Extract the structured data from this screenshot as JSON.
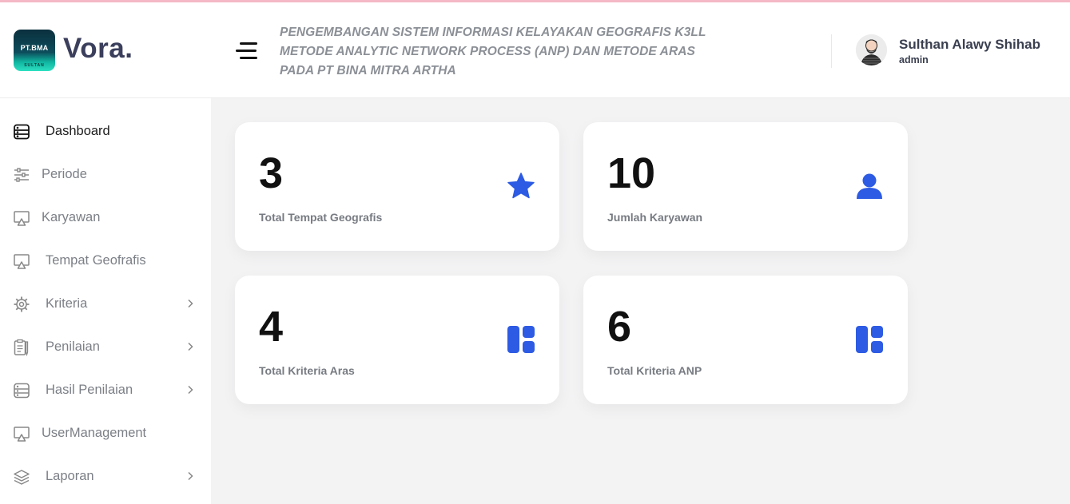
{
  "header": {
    "logo_top": "PT.BMA",
    "logo_bottom": "SULTAN",
    "brand": "Vora.",
    "title_line1": "PENGEMBANGAN SISTEM INFORMASI KELAYAKAN GEOGRAFIS K3LL",
    "title_line2": "METODE ANALYTIC NETWORK PROCESS (ANP) DAN METODE ARAS",
    "title_line3": "PADA PT BINA MITRA ARTHA",
    "user_name": "Sulthan Alawy Shihab",
    "user_role": "admin"
  },
  "sidebar": {
    "items": [
      {
        "label": "Dashboard",
        "icon": "dashboard-icon",
        "active": true
      },
      {
        "label": "Periode",
        "icon": "sliders-icon"
      },
      {
        "label": "Karyawan",
        "icon": "monitor-icon"
      },
      {
        "label": "Tempat Geofrafis",
        "icon": "monitor-icon"
      },
      {
        "label": "Kriteria",
        "icon": "gear-icon",
        "chevron": true
      },
      {
        "label": "Penilaian",
        "icon": "clipboard-icon",
        "chevron": true
      },
      {
        "label": "Hasil Penilaian",
        "icon": "server-icon",
        "chevron": true
      },
      {
        "label": "UserManagement",
        "icon": "monitor-icon"
      },
      {
        "label": "Laporan",
        "icon": "layers-icon",
        "chevron": true
      }
    ]
  },
  "cards": [
    {
      "value": "3",
      "label": "Total Tempat Geografis",
      "icon": "star-icon"
    },
    {
      "value": "10",
      "label": "Jumlah Karyawan",
      "icon": "user-icon"
    },
    {
      "value": "4",
      "label": "Total Kriteria Aras",
      "icon": "grid-icon"
    },
    {
      "value": "6",
      "label": "Total Kriteria ANP",
      "icon": "grid-icon"
    }
  ],
  "colors": {
    "accent": "#2d5be3",
    "sidebar_text": "#7b7f86",
    "title_text": "#8b8f96"
  }
}
